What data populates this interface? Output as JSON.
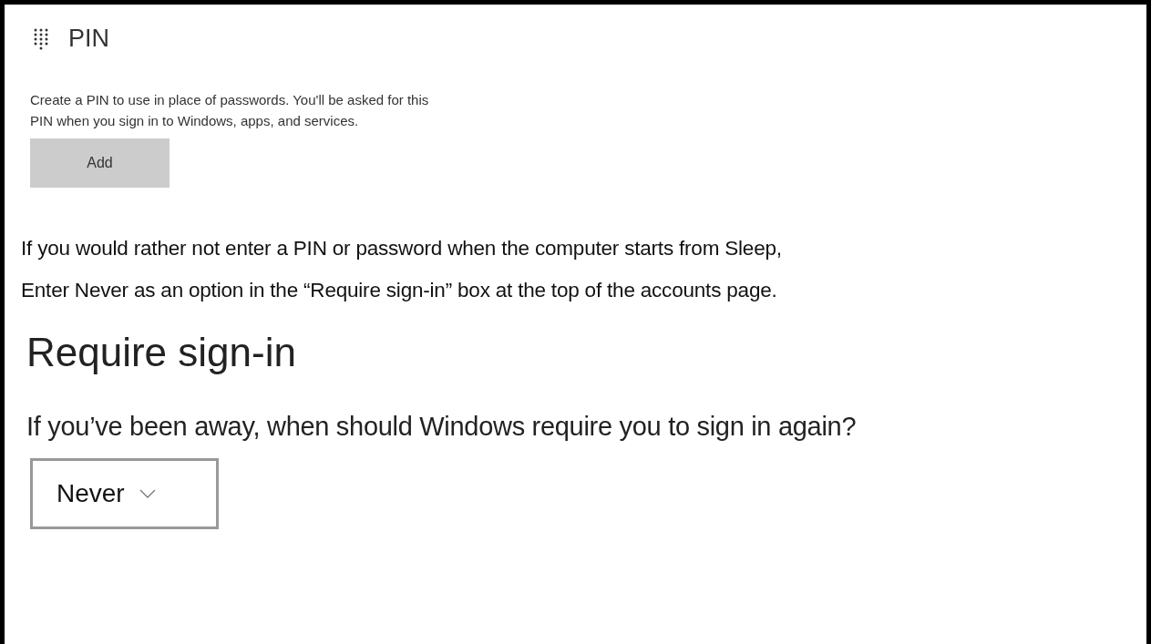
{
  "pin": {
    "title": "PIN",
    "description": [
      "Create a PIN to use in place of passwords. You'll be asked for this",
      "PIN when you sign in to Windows, apps, and services."
    ],
    "add_button": "Add"
  },
  "note": [
    "If you would rather not enter a PIN or password when the computer starts from Sleep,",
    "Enter Never as an option in the “Require sign-in” box at the top of the accounts page."
  ],
  "require_signin": {
    "title": "Require sign-in",
    "question": "If you’ve been away, when should Windows require you to sign in again?",
    "dropdown": {
      "value": "Never"
    }
  }
}
